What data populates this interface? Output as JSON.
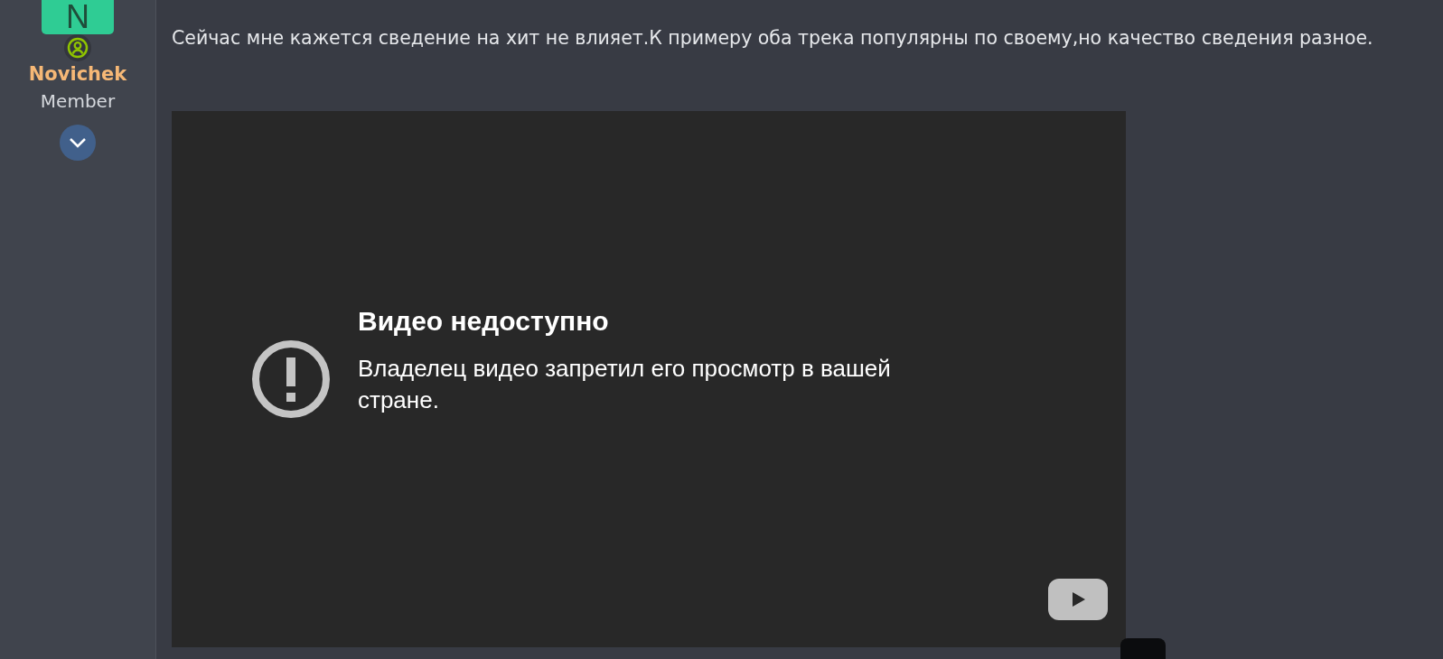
{
  "author": {
    "avatar_letter": "N",
    "name": "Novichek",
    "role": "Member"
  },
  "post": {
    "text": "Сейчас мне кажется сведение на хит не влияет.К примеру оба трека популярны по своему,но качество сведения разное.",
    "video": {
      "title": "Видео недоступно",
      "message": "Владелец видео запретил его просмотр в вашей стране."
    }
  }
}
